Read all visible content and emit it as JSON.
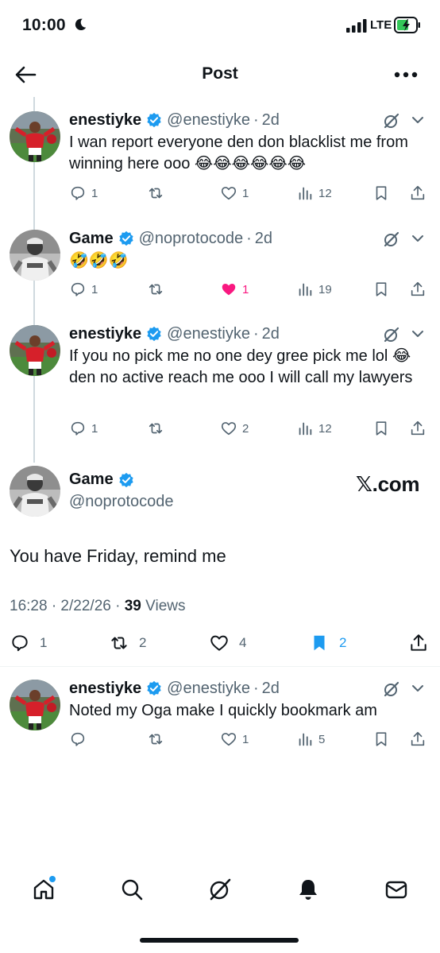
{
  "status_bar": {
    "time": "10:00",
    "network": "LTE"
  },
  "header": {
    "title": "Post"
  },
  "replies_above": [
    {
      "name": "enestiyke",
      "handle": "@enestiyke",
      "time": "2d",
      "text": "I wan report everyone den don blacklist me from winning here ooo 😂😂😂😂😂😂",
      "replies": "1",
      "reposts": "",
      "likes": "1",
      "views": "12",
      "liked": false
    },
    {
      "name": "Game",
      "handle": "@noprotocode",
      "time": "2d",
      "text": "🤣🤣🤣",
      "replies": "1",
      "reposts": "",
      "likes": "1",
      "views": "19",
      "liked": true
    },
    {
      "name": "enestiyke",
      "handle": "@enestiyke",
      "time": "2d",
      "text": "If you no pick me no one dey gree pick me lol 😂 den no active reach me ooo I will call my lawyers",
      "replies": "1",
      "reposts": "",
      "likes": "2",
      "views": "12",
      "liked": false
    }
  ],
  "main_post": {
    "name": "Game",
    "handle": "@noprotocode",
    "watermark": "𝕏.com",
    "text": "You have Friday, remind me",
    "timestamp": "16:28 · 2/22/26 · ",
    "views_count": "39",
    "views_label": " Views",
    "replies": "1",
    "reposts": "2",
    "likes": "4",
    "bookmarks": "2"
  },
  "reply_below": {
    "name": "enestiyke",
    "handle": "@enestiyke",
    "time": "2d",
    "text": "Noted my Oga make I quickly bookmark am",
    "replies": "",
    "reposts": "",
    "likes": "1",
    "views": "5",
    "liked": false
  },
  "tabbar": {
    "items": [
      "home-icon",
      "search-icon",
      "grok-icon",
      "notifications-icon",
      "messages-icon"
    ]
  },
  "colors": {
    "accent": "#1d9bf0",
    "like": "#f91880",
    "muted": "#536471",
    "text": "#0f1419"
  }
}
